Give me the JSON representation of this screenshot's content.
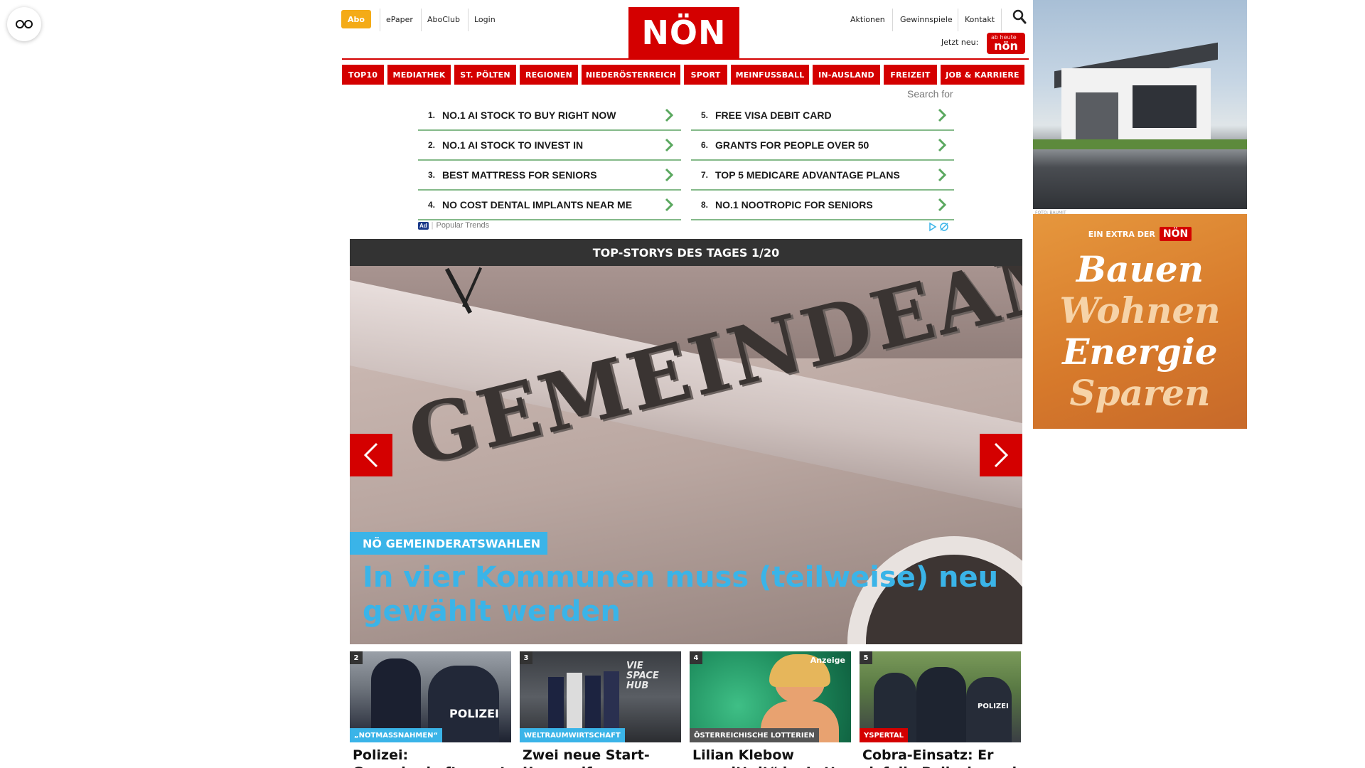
{
  "topbar": {
    "abo": "Abo",
    "epaper": "ePaper",
    "aboclub": "AboClub",
    "login": "Login",
    "aktionen": "Aktionen",
    "gewinnspiele": "Gewinnspiele",
    "kontakt": "Kontakt",
    "jetzt_neu": "Jetzt neu:",
    "jetzt_badge": "nön",
    "jetzt_badge_small": "ab heute"
  },
  "logo": "NÖN",
  "nav": [
    "TOP10",
    "MEDIATHEK",
    "ST. PÖLTEN",
    "REGIONEN",
    "NIEDERÖSTERREICH",
    "SPORT",
    "MEINFUSSBALL",
    "IN-AUSLAND",
    "FREIZEIT",
    "JOB & KARRIERE"
  ],
  "ad_search": {
    "search_for": "Search for",
    "left": [
      {
        "num": "1.",
        "text": "NO.1 AI STOCK TO BUY RIGHT NOW"
      },
      {
        "num": "2.",
        "text": "NO.1 AI STOCK TO INVEST IN"
      },
      {
        "num": "3.",
        "text": "BEST MATTRESS FOR SENIORS"
      },
      {
        "num": "4.",
        "text": "NO COST DENTAL IMPLANTS NEAR ME"
      }
    ],
    "right": [
      {
        "num": "5.",
        "text": "FREE VISA DEBIT CARD"
      },
      {
        "num": "6.",
        "text": "GRANTS FOR PEOPLE OVER 50"
      },
      {
        "num": "7.",
        "text": "TOP 5 MEDICARE ADVANTAGE PLANS"
      },
      {
        "num": "8.",
        "text": "NO.1 NOOTROPIC FOR SENIORS"
      }
    ],
    "ad_label": "Ad",
    "footer": "Popular Trends"
  },
  "top_stories": {
    "header": "TOP-STORYS DES TAGES 1/20",
    "hero_image_text": "GEMEINDEAMT",
    "hero_tag": "NÖ GEMEINDERATSWAHLEN",
    "hero_title": "In vier Kommunen muss (teilweise) neu gewählt werden"
  },
  "cards": [
    {
      "num": "2",
      "tag": "„NOTMASSNAHMEN“",
      "tag_color": "#3ab4e8",
      "title": "Polizei: Gewerkschaft warnt vor Einsparungen",
      "img_text": "POLIZEI",
      "anzeige": ""
    },
    {
      "num": "3",
      "tag": "WELTRAUMWIRTSCHAFT",
      "tag_color": "#3ab4e8",
      "title": "Zwei neue Start-Ups greifen am Flughafen",
      "img_text": "VIE SPACE HUB",
      "anzeige": ""
    },
    {
      "num": "4",
      "tag": "ÖSTERREICHISCHE LOTTERIEN",
      "tag_color": "#555555",
      "title": "Lilian Klebow „ermittelt“ im Lotto Studio",
      "img_text": "",
      "anzeige": "Anzeige"
    },
    {
      "num": "5",
      "tag": "YSPERTAL",
      "tag_color": "#d40000",
      "title": "Cobra-Einsatz: Er rief die Polizei – und zog dann",
      "img_text": "POLIZEI",
      "anzeige": ""
    }
  ],
  "side_ads": {
    "foto_credit": "FOTO: BAUMIT",
    "bauen_head": "EIN EXTRA DER",
    "bauen_logo": "NÖN",
    "words": [
      "Bauen",
      "Wohnen",
      "Energie",
      "Sparen"
    ]
  },
  "colors": {
    "brand_red": "#d40000",
    "abo_yellow": "#f4ab17",
    "story_blue": "#3ab4e8",
    "ad_green": "#84b989"
  }
}
